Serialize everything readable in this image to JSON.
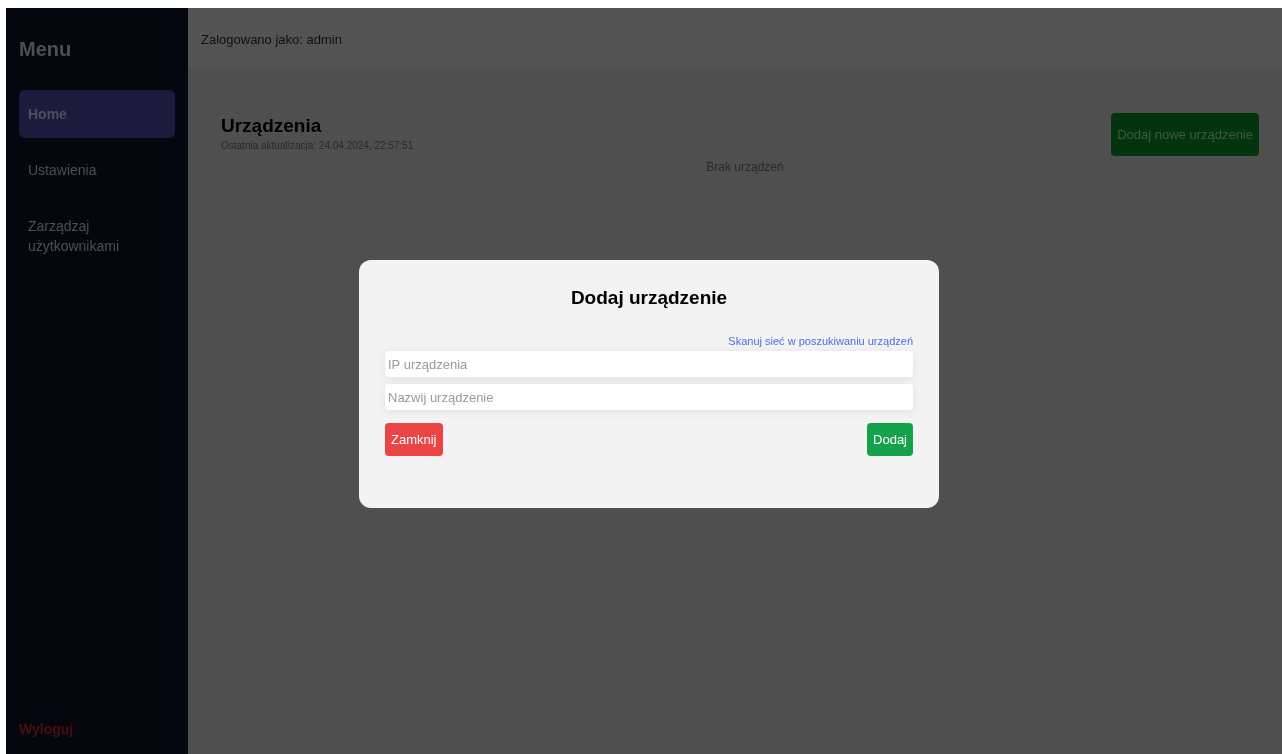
{
  "sidebar": {
    "title": "Menu",
    "items": [
      {
        "label": "Home",
        "selected": true
      },
      {
        "label": "Ustawienia",
        "selected": false
      },
      {
        "label": "Zarządzaj użytkownikami",
        "selected": false
      }
    ],
    "logout": "Wyloguj"
  },
  "header": {
    "user": "Zalogowano jako: admin"
  },
  "devices": {
    "title": "Urządzenia",
    "updated": "Ostatnia aktualizacja: 24.04.2024, 22:57:51",
    "add_button": "Dodaj nowe urządzenie",
    "empty": "Brak urządzeń"
  },
  "dialog": {
    "title": "Dodaj urządzenie",
    "scan_link": "Skanuj sieć w poszukiwaniu urządzeń",
    "fields": [
      {
        "placeholder": "IP urządzenia"
      },
      {
        "placeholder": "Nazwij urządzenie"
      }
    ],
    "close_button": "Zamknij",
    "add_button": "Dodaj"
  }
}
